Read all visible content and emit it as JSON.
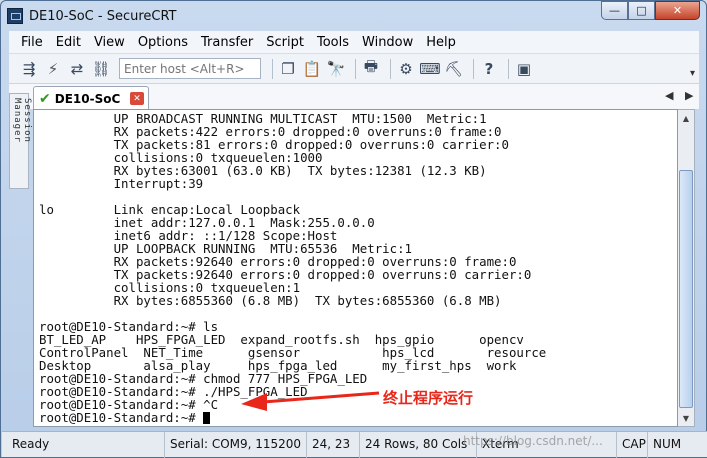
{
  "window": {
    "title": "DE10-SoC - SecureCRT"
  },
  "window_buttons": {
    "minimize": "—",
    "maximize": "□",
    "close": "✕"
  },
  "menu": [
    "File",
    "Edit",
    "View",
    "Options",
    "Transfer",
    "Script",
    "Tools",
    "Window",
    "Help"
  ],
  "toolbar": {
    "host_placeholder": "Enter host <Alt+R>"
  },
  "tab": {
    "label": "DE10-SoC"
  },
  "side_panel": {
    "label": "Session Manager"
  },
  "terminal": {
    "lines": [
      "          UP BROADCAST RUNNING MULTICAST  MTU:1500  Metric:1",
      "          RX packets:422 errors:0 dropped:0 overruns:0 frame:0",
      "          TX packets:81 errors:0 dropped:0 overruns:0 carrier:0",
      "          collisions:0 txqueuelen:1000",
      "          RX bytes:63001 (63.0 KB)  TX bytes:12381 (12.3 KB)",
      "          Interrupt:39",
      "",
      "lo        Link encap:Local Loopback",
      "          inet addr:127.0.0.1  Mask:255.0.0.0",
      "          inet6 addr: ::1/128 Scope:Host",
      "          UP LOOPBACK RUNNING  MTU:65536  Metric:1",
      "          RX packets:92640 errors:0 dropped:0 overruns:0 frame:0",
      "          TX packets:92640 errors:0 dropped:0 overruns:0 carrier:0",
      "          collisions:0 txqueuelen:1",
      "          RX bytes:6855360 (6.8 MB)  TX bytes:6855360 (6.8 MB)",
      "",
      "root@DE10-Standard:~# ls",
      "BT_LED_AP    HPS_FPGA_LED  expand_rootfs.sh  hps_gpio      opencv",
      "ControlPanel  NET_Time      gsensor           hps_lcd       resource",
      "Desktop       alsa_play     hps_fpga_led      my_first_hps  work",
      "root@DE10-Standard:~# chmod 777 HPS_FPGA_LED",
      "root@DE10-Standard:~# ./HPS_FPGA_LED",
      "root@DE10-Standard:~# ^C",
      "root@DE10-Standard:~# "
    ]
  },
  "annotation": {
    "text": "终止程序运行",
    "color": "#e8261a"
  },
  "status": {
    "ready": "Ready",
    "serial": "Serial: COM9, 115200",
    "position": "24,  23",
    "size": "24 Rows, 80 Cols",
    "terminal_type": "Xterm",
    "caps": "CAP",
    "num": "NUM"
  },
  "watermark": "https://blog.csdn.net/..."
}
